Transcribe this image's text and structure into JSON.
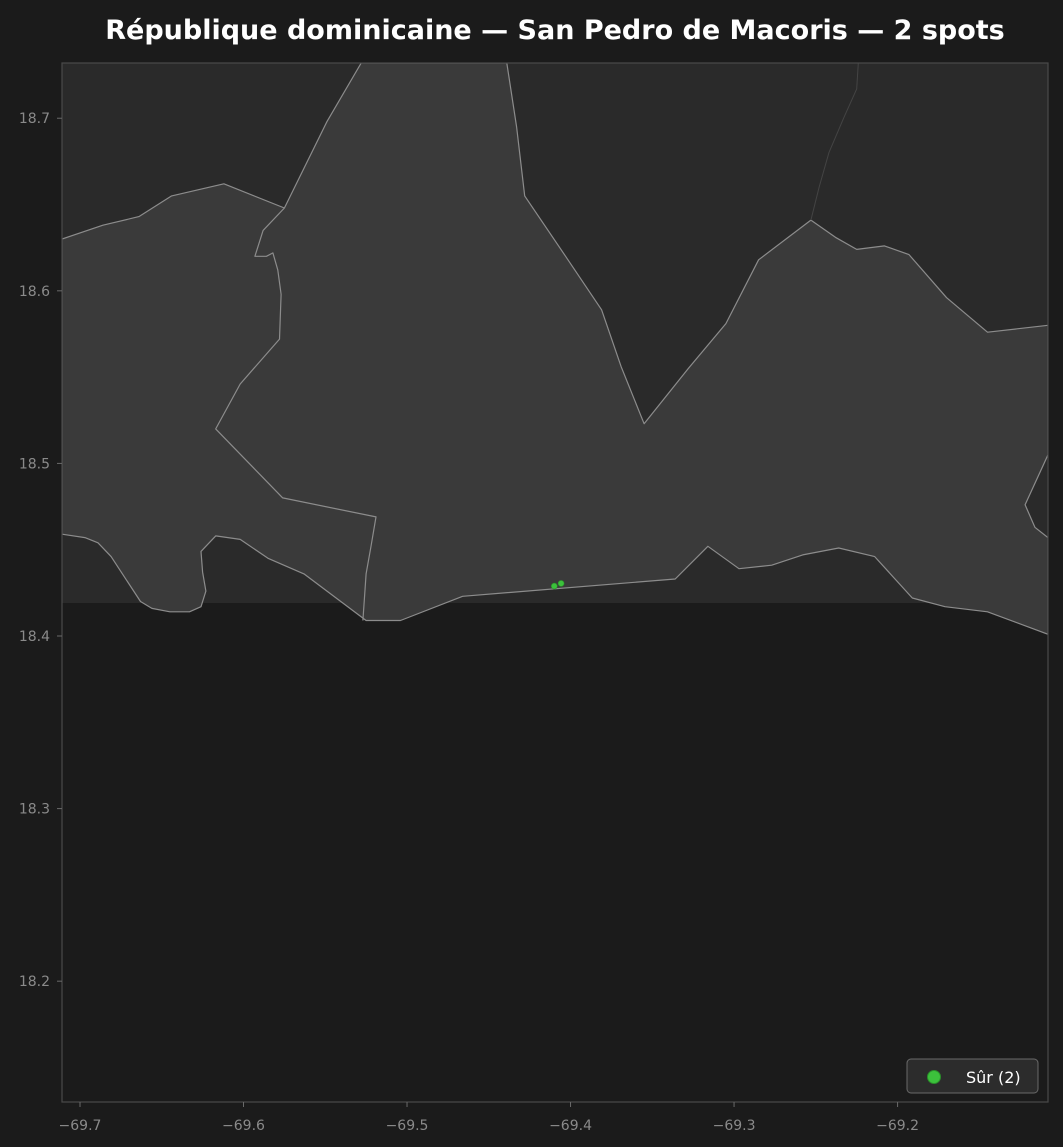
{
  "title": "République dominicaine — San Pedro de Macoris — 2 spots",
  "chart_data": {
    "type": "scatter",
    "title": "République dominicaine — San Pedro de Macoris — 2 spots",
    "xlim": [
      -69.711,
      -69.108
    ],
    "ylim": [
      18.13,
      18.732
    ],
    "x_ticks": [
      {
        "value": -69.7,
        "label": "−69.7"
      },
      {
        "value": -69.6,
        "label": "−69.6"
      },
      {
        "value": -69.5,
        "label": "−69.5"
      },
      {
        "value": -69.4,
        "label": "−69.4"
      },
      {
        "value": -69.3,
        "label": "−69.3"
      },
      {
        "value": -69.2,
        "label": "−69.2"
      }
    ],
    "y_ticks": [
      {
        "value": 18.7,
        "label": "18.7"
      },
      {
        "value": 18.6,
        "label": "18.6"
      },
      {
        "value": 18.5,
        "label": "18.5"
      },
      {
        "value": 18.4,
        "label": "18.4"
      },
      {
        "value": 18.3,
        "label": "18.3"
      },
      {
        "value": 18.2,
        "label": "18.2"
      }
    ],
    "grid": false,
    "legend_position": "bottom-right",
    "series": [
      {
        "name": "Sûr (2)",
        "color": "#3cc13c",
        "points": [
          {
            "x": -69.4099,
            "y": 18.4289
          },
          {
            "x": -69.4058,
            "y": 18.4305
          }
        ]
      }
    ],
    "regions": [
      {
        "name": "mainland",
        "fill": "#3a3a3a",
        "outline": [
          [
            -69.711,
            18.63
          ],
          [
            -69.686,
            18.638
          ],
          [
            -69.664,
            18.643
          ],
          [
            -69.644,
            18.655
          ],
          [
            -69.612,
            18.662
          ],
          [
            -69.575,
            18.648
          ],
          [
            -69.549,
            18.698
          ],
          [
            -69.528,
            18.732
          ],
          [
            -69.439,
            18.732
          ],
          [
            -69.433,
            18.695
          ],
          [
            -69.428,
            18.655
          ],
          [
            -69.403,
            18.62
          ],
          [
            -69.381,
            18.589
          ],
          [
            -69.369,
            18.556
          ],
          [
            -69.355,
            18.523
          ],
          [
            -69.328,
            18.555
          ],
          [
            -69.305,
            18.581
          ],
          [
            -69.285,
            18.618
          ],
          [
            -69.253,
            18.641
          ],
          [
            -69.238,
            18.631
          ],
          [
            -69.225,
            18.624
          ],
          [
            -69.208,
            18.626
          ],
          [
            -69.193,
            18.621
          ],
          [
            -69.17,
            18.596
          ],
          [
            -69.145,
            18.576
          ],
          [
            -69.108,
            18.58
          ],
          [
            -69.108,
            18.505
          ],
          [
            -69.122,
            18.476
          ],
          [
            -69.116,
            18.463
          ],
          [
            -69.108,
            18.457
          ],
          [
            -69.108,
            18.401
          ],
          [
            -69.145,
            18.414
          ],
          [
            -69.171,
            18.417
          ],
          [
            -69.191,
            18.422
          ],
          [
            -69.214,
            18.446
          ],
          [
            -69.236,
            18.451
          ],
          [
            -69.258,
            18.447
          ],
          [
            -69.277,
            18.441
          ],
          [
            -69.297,
            18.439
          ],
          [
            -69.316,
            18.452
          ],
          [
            -69.336,
            18.433
          ],
          [
            -69.466,
            18.423
          ],
          [
            -69.504,
            18.409
          ],
          [
            -69.525,
            18.409
          ],
          [
            -69.563,
            18.436
          ],
          [
            -69.585,
            18.445
          ],
          [
            -69.602,
            18.456
          ],
          [
            -69.617,
            18.458
          ],
          [
            -69.626,
            18.449
          ],
          [
            -69.625,
            18.437
          ],
          [
            -69.623,
            18.426
          ],
          [
            -69.626,
            18.417
          ],
          [
            -69.633,
            18.414
          ],
          [
            -69.645,
            18.414
          ],
          [
            -69.656,
            18.416
          ],
          [
            -69.663,
            18.42
          ],
          [
            -69.681,
            18.446
          ],
          [
            -69.689,
            18.454
          ],
          [
            -69.697,
            18.457
          ],
          [
            -69.711,
            18.459
          ]
        ]
      }
    ],
    "boundaries": [
      [
        [
          -69.575,
          18.648
        ],
        [
          -69.588,
          18.635
        ],
        [
          -69.593,
          18.62
        ],
        [
          -69.586,
          18.62
        ],
        [
          -69.582,
          18.622
        ],
        [
          -69.579,
          18.612
        ],
        [
          -69.577,
          18.598
        ],
        [
          -69.578,
          18.572
        ],
        [
          -69.602,
          18.546
        ],
        [
          -69.617,
          18.52
        ],
        [
          -69.576,
          18.48
        ],
        [
          -69.519,
          18.469
        ],
        [
          -69.522,
          18.452
        ],
        [
          -69.525,
          18.436
        ],
        [
          -69.527,
          18.409
        ]
      ],
      [
        [
          -69.253,
          18.641
        ],
        [
          -69.248,
          18.66
        ],
        [
          -69.242,
          18.68
        ],
        [
          -69.233,
          18.7
        ],
        [
          -69.225,
          18.717
        ],
        [
          -69.224,
          18.732
        ]
      ]
    ]
  },
  "legend": {
    "marker_label": "Sûr (2)",
    "marker_color": "#3cc13c"
  },
  "colors": {
    "page_background": "#1b1b1b",
    "plot_background": "#2a2a2a",
    "sea": "#1b1b1b",
    "land": "#3a3a3a",
    "boundary": "#8c8c8c",
    "frame": "#4a4a4a",
    "tick_text": "#8a8a8a",
    "title_text": "#ffffff"
  }
}
